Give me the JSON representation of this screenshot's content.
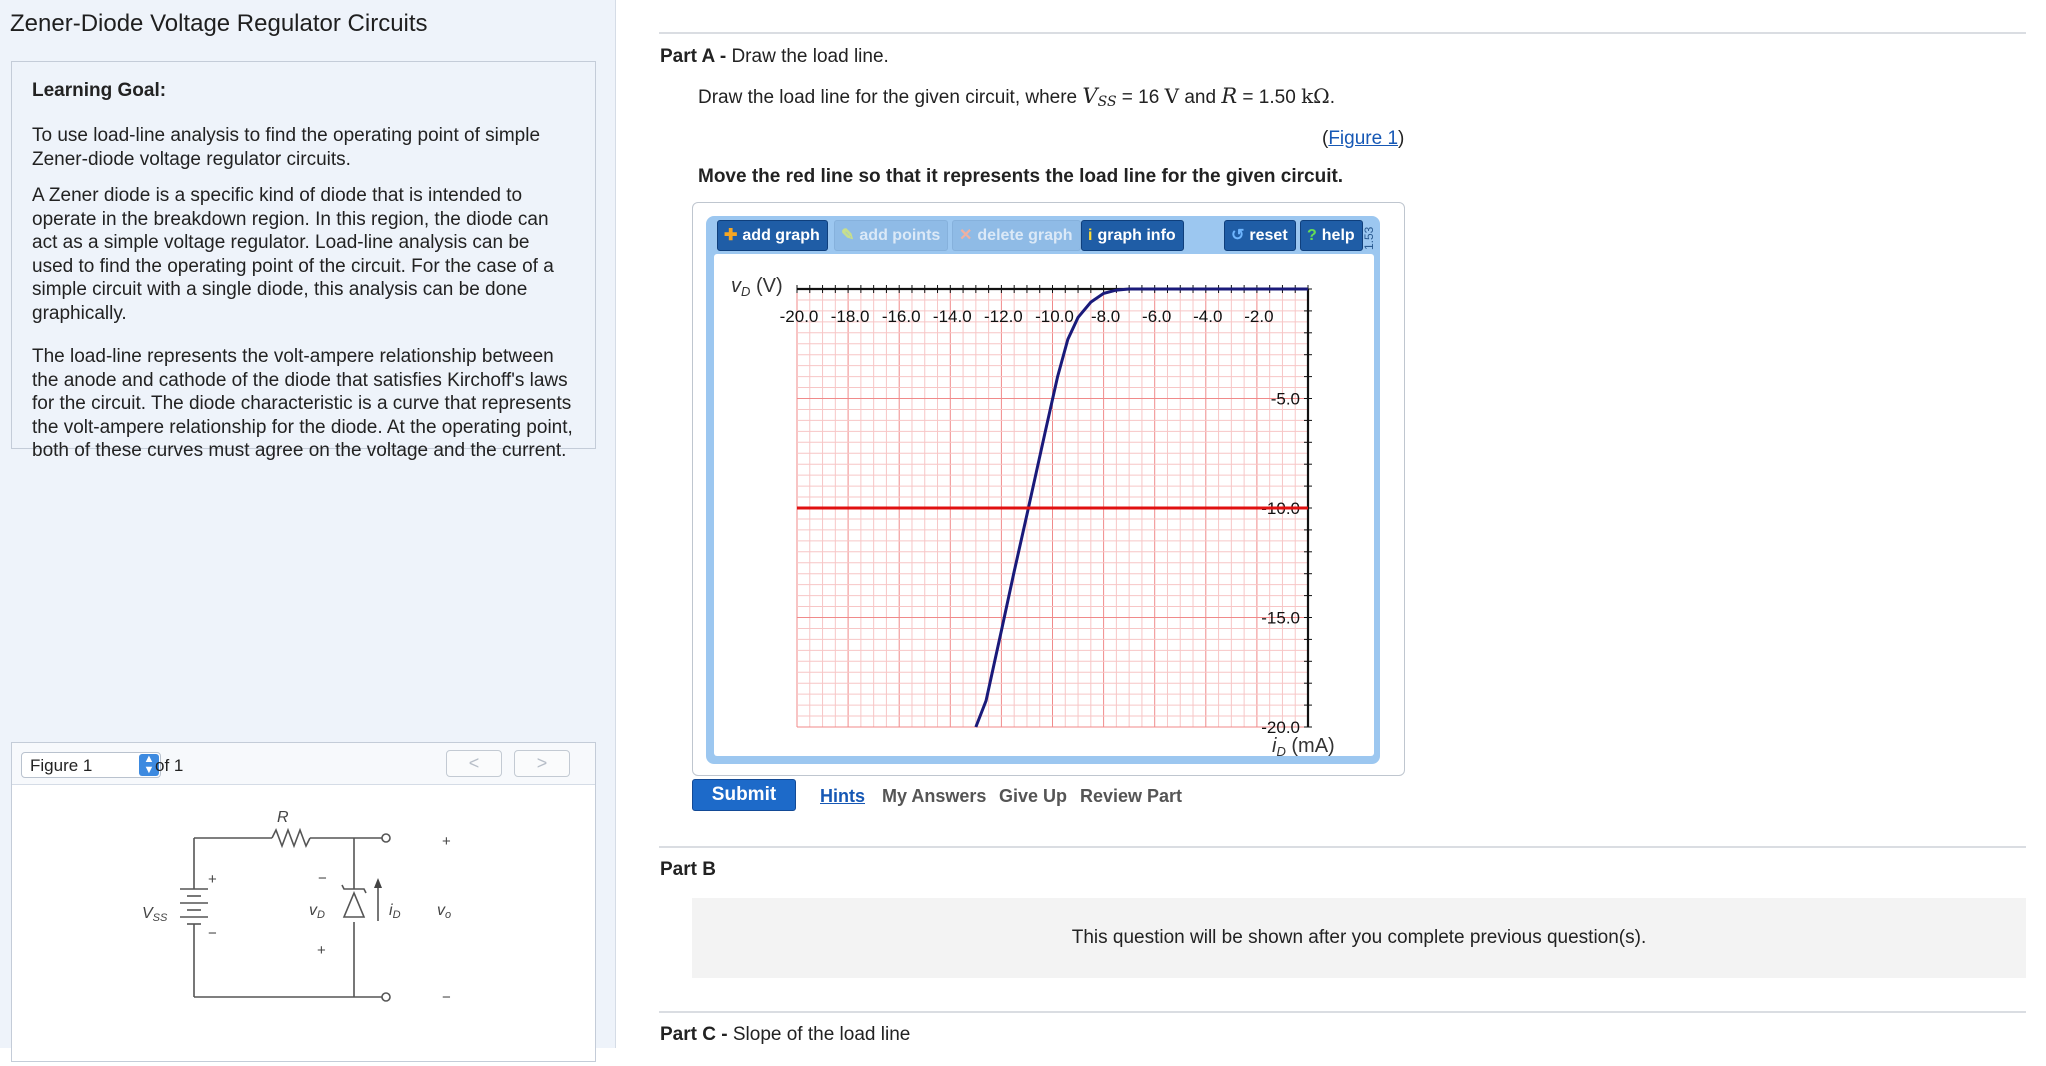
{
  "left": {
    "title": "Zener-Diode Voltage Regulator Circuits",
    "goal_heading": "Learning Goal:",
    "paragraphs": [
      "To use load-line analysis to find the operating point of simple Zener-diode voltage regulator circuits.",
      "A Zener diode is a specific kind of diode that is intended to operate in the breakdown region. In this region, the diode can act as a simple voltage regulator. Load-line analysis can be used to find the operating point of the circuit. For the case of a simple circuit with a single diode, this analysis can be done graphically.",
      "The load-line represents the volt-ampere relationship between the anode and cathode of the diode that satisfies Kirchoff's laws for the circuit. The diode characteristic is a curve that represents the volt-ampere relationship for the diode. At the operating point, both of these curves must agree on the voltage and the current."
    ],
    "figure": {
      "select_value": "Figure 1",
      "of_text": "of 1",
      "prev": "<",
      "next": ">",
      "labels": {
        "R": "R",
        "Vss": "V",
        "Vss_sub": "SS",
        "vD": "v",
        "vD_sub": "D",
        "iD": "i",
        "iD_sub": "D",
        "vo": "v",
        "vo_sub": "o",
        "plus": "+",
        "minus": "−"
      }
    }
  },
  "partA": {
    "label_bold": "Part A -",
    "label_rest": " Draw the load line.",
    "q_before": "Draw the load line for the given circuit, where ",
    "q_vss": "V",
    "q_vss_sub": "SS",
    "q_mid1": " = 16 ",
    "q_V": "V",
    "q_and": " and ",
    "q_R": "R",
    "q_mid2": " = 1.50 ",
    "q_unit": "kΩ",
    "q_end": ".",
    "fig_open": "(",
    "fig_link": "Figure 1",
    "fig_close": ")",
    "instruction": "Move the red line so that it represents the load line for the given circuit."
  },
  "toolbar": {
    "add_graph": "add graph",
    "add_points": "add points",
    "delete_graph": "delete graph",
    "graph_info": "graph info",
    "reset": "reset",
    "help": "help",
    "version": "1.53"
  },
  "chart_data": {
    "type": "line",
    "xlabel_sym": "v",
    "xlabel_sub": "D",
    "xlabel_unit": " (V)",
    "ylabel_sym": "i",
    "ylabel_sub": "D",
    "ylabel_unit": " (mA)",
    "xlim": [
      -20,
      0
    ],
    "ylim": [
      -20,
      0
    ],
    "x_ticks": [
      "-20.0",
      "-18.0",
      "-16.0",
      "-14.0",
      "-12.0",
      "-10.0",
      "-8.0",
      "-6.0",
      "-4.0",
      "-2.0"
    ],
    "x_tick_values": [
      -20,
      -18,
      -16,
      -14,
      -12,
      -10,
      -8,
      -6,
      -4,
      -2
    ],
    "y_ticks": [
      "-5.0",
      "-10.0",
      "-15.0",
      "-20.0"
    ],
    "y_tick_values": [
      -5,
      -10,
      -15,
      -20
    ],
    "series": [
      {
        "color": "#1a1a7a",
        "x": [
          -7.0,
          -7.5,
          -8.0,
          -8.5,
          -9.0,
          -9.4,
          -9.8,
          -10.3,
          -11.0,
          -11.5,
          -12.0,
          -12.6,
          -13.0
        ],
        "y": [
          0.0,
          -0.05,
          -0.2,
          -0.6,
          -1.3,
          -2.3,
          -4.0,
          -6.6,
          -10.3,
          -12.9,
          -15.6,
          -18.8,
          -20.0
        ]
      },
      {
        "color": "#e01010",
        "x": [
          -20,
          0
        ],
        "y": [
          -10,
          -10
        ]
      }
    ]
  },
  "actions": {
    "submit": "Submit",
    "hints": "Hints",
    "my_answers": "My Answers",
    "give_up": "Give Up",
    "review_part": "Review Part"
  },
  "partB": {
    "label": "Part B",
    "message": "This question will be shown after you complete previous question(s)."
  },
  "partC": {
    "label_bold": "Part C -",
    "label_rest": " Slope of the load line"
  }
}
